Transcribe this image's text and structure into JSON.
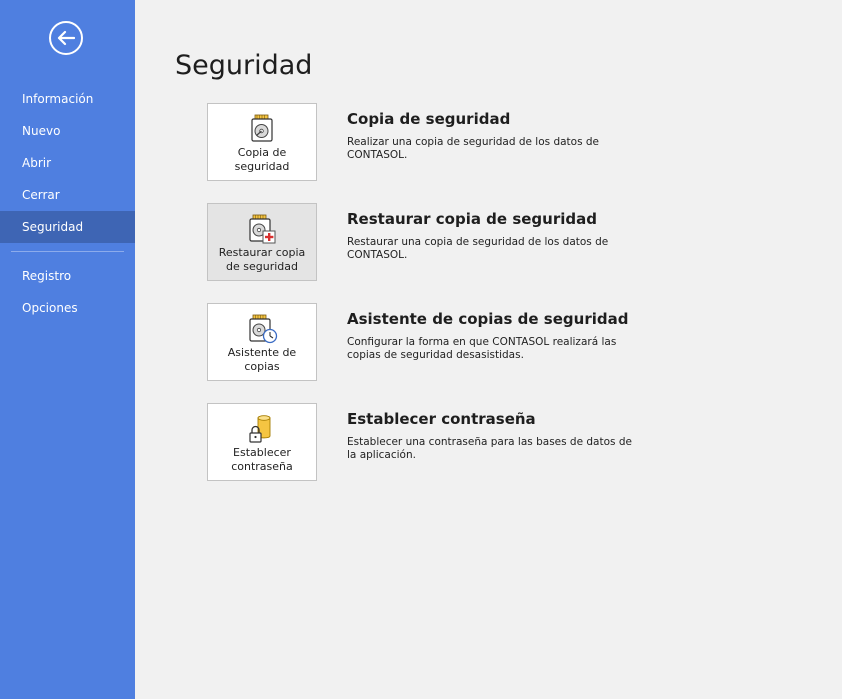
{
  "sidebar": {
    "items": [
      {
        "label": "Información"
      },
      {
        "label": "Nuevo"
      },
      {
        "label": "Abrir"
      },
      {
        "label": "Cerrar"
      },
      {
        "label": "Seguridad",
        "active": true
      },
      {
        "label": "Registro"
      },
      {
        "label": "Opciones"
      }
    ]
  },
  "main": {
    "title": "Seguridad",
    "options": [
      {
        "icon": "backup-disk-icon",
        "button_label": "Copia de seguridad",
        "title": "Copia de seguridad",
        "description": "Realizar una copia de seguridad de los datos de CONTASOL."
      },
      {
        "icon": "restore-disk-icon",
        "button_label": "Restaurar copia de seguridad",
        "title": "Restaurar copia de seguridad",
        "description": "Restaurar una copia de seguridad de los datos de CONTASOL."
      },
      {
        "icon": "backup-wizard-clock-icon",
        "button_label": "Asistente de copias",
        "title": "Asistente de copias de seguridad",
        "description": "Configurar la forma en que CONTASOL realizará las copias de seguridad desasistidas."
      },
      {
        "icon": "lock-database-icon",
        "button_label": "Establecer contraseña",
        "title": "Establecer contraseña",
        "description": "Establecer una contraseña para las bases de datos de la aplicación."
      }
    ]
  },
  "colors": {
    "sidebar_bg": "#4f7fe0",
    "sidebar_active": "#3e65b4",
    "content_bg": "#f1f1f1"
  }
}
